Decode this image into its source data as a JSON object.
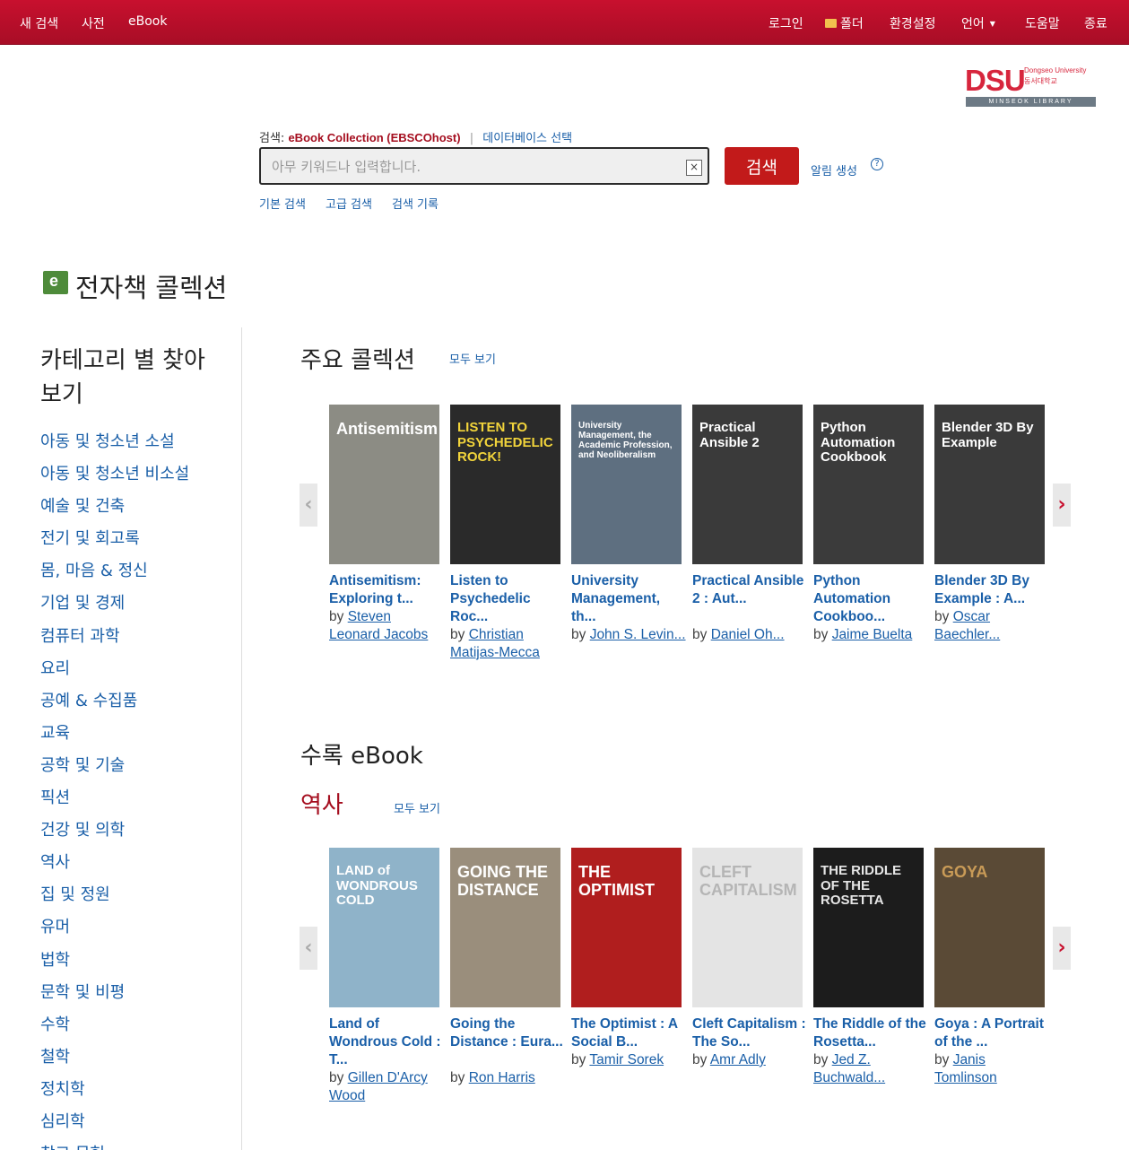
{
  "topnav": {
    "left": [
      "새 검색",
      "사전",
      "eBook"
    ],
    "login": "로그인",
    "folder": "폴더",
    "prefs": "환경설정",
    "language": "언어",
    "help": "도움말",
    "exit": "종료"
  },
  "logo": {
    "main": "DSU",
    "uni_en": "Dongseo University",
    "uni_ko": "동서대학교",
    "bar": "MINSEOK LIBRARY"
  },
  "search": {
    "label_prefix": "검색:",
    "collection": "eBook Collection (EBSCOhost)",
    "db_select": "데이터베이스 선택",
    "placeholder": "아무 키워드나 입력합니다.",
    "button": "검색",
    "alert": "알림 생성",
    "links": [
      "기본 검색",
      "고급 검색",
      "검색 기록"
    ]
  },
  "page_title": "전자책 콜렉션",
  "sidebar": {
    "heading": "카테고리 별 찾아 보기",
    "categories": [
      "아동 및 청소년 소설",
      "아동 및 청소년 비소설",
      "예술 및 건축",
      "전기 및 회고록",
      "몸, 마음 & 정신",
      "기업 및 경제",
      "컴퓨터 과학",
      "요리",
      "공예 & 수집품",
      "교육",
      "공학 및 기술",
      "픽션",
      "건강 및 의학",
      "역사",
      "집 및 정원",
      "유머",
      "법학",
      "문학 및 비평",
      "수학",
      "철학",
      "정치학",
      "심리학",
      "참고 문헌"
    ]
  },
  "featured": {
    "title": "주요 콜렉션",
    "see_all": "모두 보기",
    "books": [
      {
        "title": "Antisemitism: Exploring t...",
        "by": "by",
        "author": "Steven Leonard Jacobs",
        "cover_text": "Antisemitism",
        "cover_bg": "#8c8c84",
        "cover_fg": "#ffffff"
      },
      {
        "title": "Listen to Psychedelic Roc...",
        "by": "by",
        "author": "Christian Matijas-Mecca",
        "cover_text": "LISTEN TO PSYCHEDELIC ROCK!",
        "cover_bg": "#2a2a2a",
        "cover_fg": "#f2d43b"
      },
      {
        "title": "University Management, th...",
        "by": "by",
        "author": "John S. Levin...",
        "cover_text": "University Management, the Academic Profession, and Neoliberalism",
        "cover_bg": "#5e6f80",
        "cover_fg": "#ffffff"
      },
      {
        "title": "Practical Ansible 2 : Aut...",
        "by": "by",
        "author": "Daniel Oh...",
        "cover_text": "Practical Ansible 2",
        "cover_bg": "#3a3a3a",
        "cover_fg": "#ffffff"
      },
      {
        "title": "Python Automation Cookboo...",
        "by": "by",
        "author": "Jaime Buelta",
        "cover_text": "Python Automation Cookbook",
        "cover_bg": "#3b3b3b",
        "cover_fg": "#ffffff"
      },
      {
        "title": "Blender 3D By Example : A...",
        "by": "by",
        "author": "Oscar Baechler...",
        "cover_text": "Blender 3D By Example",
        "cover_bg": "#3a3a3a",
        "cover_fg": "#ffffff"
      }
    ]
  },
  "included": {
    "title": "수록 eBook",
    "subtitle": "역사",
    "see_all": "모두 보기",
    "books": [
      {
        "title": "Land of Wondrous Cold : T...",
        "by": "by",
        "author": "Gillen D'Arcy Wood",
        "cover_text": "LAND of WONDROUS COLD",
        "cover_bg": "#8fb3c9",
        "cover_fg": "#ffffff"
      },
      {
        "title": "Going the Distance : Eura...",
        "by": "by",
        "author": "Ron Harris",
        "cover_text": "GOING THE DISTANCE",
        "cover_bg": "#9a8e7c",
        "cover_fg": "#ffffff"
      },
      {
        "title": "The Optimist : A Social B...",
        "by": "by",
        "author": "Tamir Sorek",
        "cover_text": "THE OPTIMIST",
        "cover_bg": "#b01e1e",
        "cover_fg": "#ffffff"
      },
      {
        "title": "Cleft Capitalism : The So...",
        "by": "by",
        "author": "Amr Adly",
        "cover_text": "CLEFT CAPITALISM",
        "cover_bg": "#e4e4e4",
        "cover_fg": "#b5b5b5"
      },
      {
        "title": "The Riddle of the Rosetta...",
        "by": "by",
        "author": "Jed Z. Buchwald...",
        "cover_text": "THE RIDDLE OF THE ROSETTA",
        "cover_bg": "#1c1c1c",
        "cover_fg": "#e6e6e6"
      },
      {
        "title": "Goya : A Portrait of the ...",
        "by": "by",
        "author": "Janis Tomlinson",
        "cover_text": "GOYA",
        "cover_bg": "#5a4a36",
        "cover_fg": "#c99b57"
      }
    ]
  },
  "colors": {
    "topbar": "#c8102e",
    "link": "#1a5fa8",
    "accent": "#a50e1f",
    "search_button": "#c21a1a"
  },
  "icons": {
    "arrow_left": "‹",
    "arrow_right": "›",
    "clear": "×",
    "help": "?"
  }
}
